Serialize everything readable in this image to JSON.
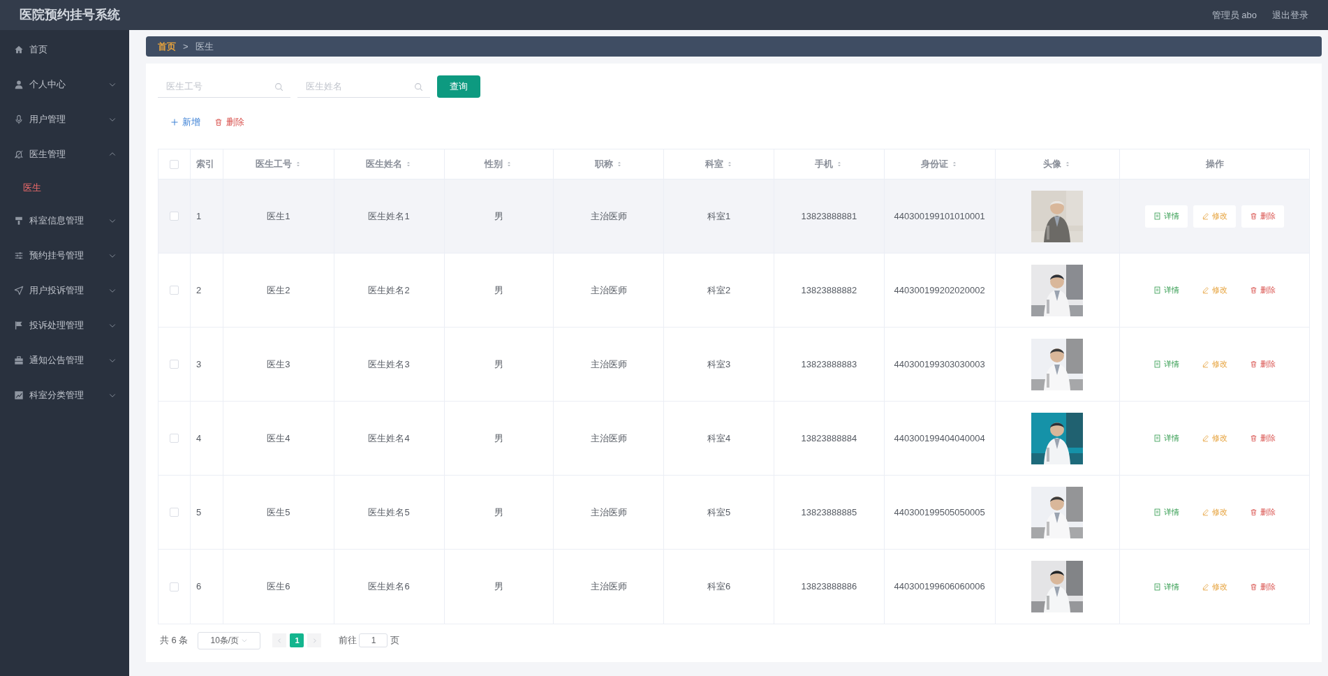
{
  "header": {
    "title": "医院预约挂号系统",
    "user": "管理员 abo",
    "logout": "退出登录"
  },
  "sidebar": {
    "items": [
      {
        "label": "首页"
      },
      {
        "label": "个人中心",
        "expanded": false
      },
      {
        "label": "用户管理",
        "expanded": false
      },
      {
        "label": "医生管理",
        "expanded": true,
        "children": [
          {
            "label": "医生",
            "selected": true
          }
        ]
      },
      {
        "label": "科室信息管理",
        "expanded": false
      },
      {
        "label": "预约挂号管理",
        "expanded": false
      },
      {
        "label": "用户投诉管理",
        "expanded": false
      },
      {
        "label": "投诉处理管理",
        "expanded": false
      },
      {
        "label": "通知公告管理",
        "expanded": false
      },
      {
        "label": "科室分类管理",
        "expanded": false
      }
    ]
  },
  "breadcrumb": [
    {
      "label": "首页",
      "current": false
    },
    {
      "separator": ">",
      "label": "医生",
      "current": true
    }
  ],
  "search": {
    "fields": [
      {
        "placeholder": "医生工号"
      },
      {
        "placeholder": "医生姓名"
      }
    ],
    "button": "查询"
  },
  "toolbar": {
    "add": "新增",
    "delete": "删除"
  },
  "table": {
    "columns": [
      {
        "label": "索引",
        "sortable": false
      },
      {
        "label": "医生工号",
        "sortable": true
      },
      {
        "label": "医生姓名",
        "sortable": true
      },
      {
        "label": "性别",
        "sortable": true
      },
      {
        "label": "职称",
        "sortable": true
      },
      {
        "label": "科室",
        "sortable": true
      },
      {
        "label": "手机",
        "sortable": true
      },
      {
        "label": "身份证",
        "sortable": true
      },
      {
        "label": "头像",
        "sortable": true
      },
      {
        "label": "操作",
        "sortable": false
      }
    ],
    "select_all_checked": false,
    "rows": [
      {
        "checked": false,
        "hovered": true,
        "cells": [
          "1",
          "医生1",
          "医生姓名1",
          "男",
          "主治医师",
          "科室1",
          "13823888881",
          "440300199101010001"
        ],
        "actions": [
          "详情",
          "修改",
          "删除"
        ]
      },
      {
        "checked": false,
        "hovered": false,
        "cells": [
          "2",
          "医生2",
          "医生姓名2",
          "男",
          "主治医师",
          "科室2",
          "13823888882",
          "440300199202020002"
        ],
        "actions": [
          "详情",
          "修改",
          "删除"
        ]
      },
      {
        "checked": false,
        "hovered": false,
        "cells": [
          "3",
          "医生3",
          "医生姓名3",
          "男",
          "主治医师",
          "科室3",
          "13823888883",
          "440300199303030003"
        ],
        "actions": [
          "详情",
          "修改",
          "删除"
        ]
      },
      {
        "checked": false,
        "hovered": false,
        "cells": [
          "4",
          "医生4",
          "医生姓名4",
          "男",
          "主治医师",
          "科室4",
          "13823888884",
          "440300199404040004"
        ],
        "actions": [
          "详情",
          "修改",
          "删除"
        ]
      },
      {
        "checked": false,
        "hovered": false,
        "cells": [
          "5",
          "医生5",
          "医生姓名5",
          "男",
          "主治医师",
          "科室5",
          "13823888885",
          "440300199505050005"
        ],
        "actions": [
          "详情",
          "修改",
          "删除"
        ]
      },
      {
        "checked": false,
        "hovered": false,
        "cells": [
          "6",
          "医生6",
          "医生姓名6",
          "男",
          "主治医师",
          "科室6",
          "13823888886",
          "440300199606060006"
        ],
        "actions": [
          "详情",
          "修改",
          "删除"
        ]
      }
    ]
  },
  "pagination": {
    "total": "共 6 条",
    "page_size": "10条/页",
    "pages": [
      {
        "label": "1",
        "selected": true
      }
    ],
    "goto_label": "前往",
    "goto_value": "1",
    "page_unit": "页"
  }
}
